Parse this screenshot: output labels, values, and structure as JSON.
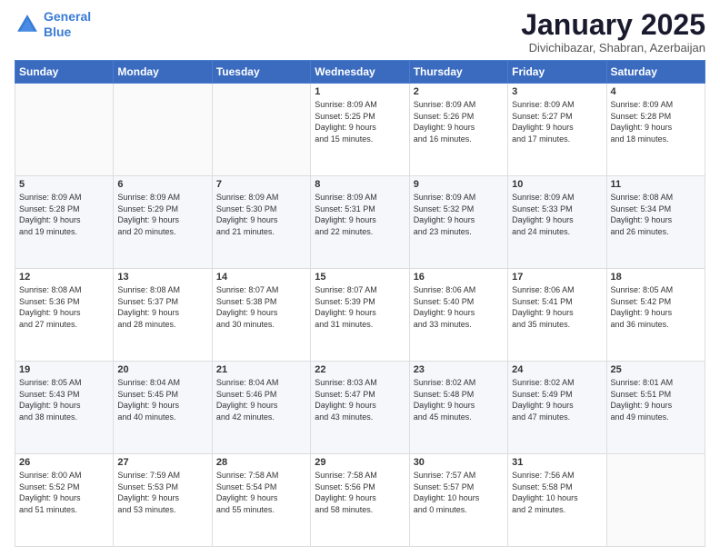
{
  "header": {
    "logo_line1": "General",
    "logo_line2": "Blue",
    "month_year": "January 2025",
    "location": "Divichibazar, Shabran, Azerbaijan"
  },
  "weekdays": [
    "Sunday",
    "Monday",
    "Tuesday",
    "Wednesday",
    "Thursday",
    "Friday",
    "Saturday"
  ],
  "weeks": [
    [
      {
        "day": "",
        "info": ""
      },
      {
        "day": "",
        "info": ""
      },
      {
        "day": "",
        "info": ""
      },
      {
        "day": "1",
        "info": "Sunrise: 8:09 AM\nSunset: 5:25 PM\nDaylight: 9 hours\nand 15 minutes."
      },
      {
        "day": "2",
        "info": "Sunrise: 8:09 AM\nSunset: 5:26 PM\nDaylight: 9 hours\nand 16 minutes."
      },
      {
        "day": "3",
        "info": "Sunrise: 8:09 AM\nSunset: 5:27 PM\nDaylight: 9 hours\nand 17 minutes."
      },
      {
        "day": "4",
        "info": "Sunrise: 8:09 AM\nSunset: 5:28 PM\nDaylight: 9 hours\nand 18 minutes."
      }
    ],
    [
      {
        "day": "5",
        "info": "Sunrise: 8:09 AM\nSunset: 5:28 PM\nDaylight: 9 hours\nand 19 minutes."
      },
      {
        "day": "6",
        "info": "Sunrise: 8:09 AM\nSunset: 5:29 PM\nDaylight: 9 hours\nand 20 minutes."
      },
      {
        "day": "7",
        "info": "Sunrise: 8:09 AM\nSunset: 5:30 PM\nDaylight: 9 hours\nand 21 minutes."
      },
      {
        "day": "8",
        "info": "Sunrise: 8:09 AM\nSunset: 5:31 PM\nDaylight: 9 hours\nand 22 minutes."
      },
      {
        "day": "9",
        "info": "Sunrise: 8:09 AM\nSunset: 5:32 PM\nDaylight: 9 hours\nand 23 minutes."
      },
      {
        "day": "10",
        "info": "Sunrise: 8:09 AM\nSunset: 5:33 PM\nDaylight: 9 hours\nand 24 minutes."
      },
      {
        "day": "11",
        "info": "Sunrise: 8:08 AM\nSunset: 5:34 PM\nDaylight: 9 hours\nand 26 minutes."
      }
    ],
    [
      {
        "day": "12",
        "info": "Sunrise: 8:08 AM\nSunset: 5:36 PM\nDaylight: 9 hours\nand 27 minutes."
      },
      {
        "day": "13",
        "info": "Sunrise: 8:08 AM\nSunset: 5:37 PM\nDaylight: 9 hours\nand 28 minutes."
      },
      {
        "day": "14",
        "info": "Sunrise: 8:07 AM\nSunset: 5:38 PM\nDaylight: 9 hours\nand 30 minutes."
      },
      {
        "day": "15",
        "info": "Sunrise: 8:07 AM\nSunset: 5:39 PM\nDaylight: 9 hours\nand 31 minutes."
      },
      {
        "day": "16",
        "info": "Sunrise: 8:06 AM\nSunset: 5:40 PM\nDaylight: 9 hours\nand 33 minutes."
      },
      {
        "day": "17",
        "info": "Sunrise: 8:06 AM\nSunset: 5:41 PM\nDaylight: 9 hours\nand 35 minutes."
      },
      {
        "day": "18",
        "info": "Sunrise: 8:05 AM\nSunset: 5:42 PM\nDaylight: 9 hours\nand 36 minutes."
      }
    ],
    [
      {
        "day": "19",
        "info": "Sunrise: 8:05 AM\nSunset: 5:43 PM\nDaylight: 9 hours\nand 38 minutes."
      },
      {
        "day": "20",
        "info": "Sunrise: 8:04 AM\nSunset: 5:45 PM\nDaylight: 9 hours\nand 40 minutes."
      },
      {
        "day": "21",
        "info": "Sunrise: 8:04 AM\nSunset: 5:46 PM\nDaylight: 9 hours\nand 42 minutes."
      },
      {
        "day": "22",
        "info": "Sunrise: 8:03 AM\nSunset: 5:47 PM\nDaylight: 9 hours\nand 43 minutes."
      },
      {
        "day": "23",
        "info": "Sunrise: 8:02 AM\nSunset: 5:48 PM\nDaylight: 9 hours\nand 45 minutes."
      },
      {
        "day": "24",
        "info": "Sunrise: 8:02 AM\nSunset: 5:49 PM\nDaylight: 9 hours\nand 47 minutes."
      },
      {
        "day": "25",
        "info": "Sunrise: 8:01 AM\nSunset: 5:51 PM\nDaylight: 9 hours\nand 49 minutes."
      }
    ],
    [
      {
        "day": "26",
        "info": "Sunrise: 8:00 AM\nSunset: 5:52 PM\nDaylight: 9 hours\nand 51 minutes."
      },
      {
        "day": "27",
        "info": "Sunrise: 7:59 AM\nSunset: 5:53 PM\nDaylight: 9 hours\nand 53 minutes."
      },
      {
        "day": "28",
        "info": "Sunrise: 7:58 AM\nSunset: 5:54 PM\nDaylight: 9 hours\nand 55 minutes."
      },
      {
        "day": "29",
        "info": "Sunrise: 7:58 AM\nSunset: 5:56 PM\nDaylight: 9 hours\nand 58 minutes."
      },
      {
        "day": "30",
        "info": "Sunrise: 7:57 AM\nSunset: 5:57 PM\nDaylight: 10 hours\nand 0 minutes."
      },
      {
        "day": "31",
        "info": "Sunrise: 7:56 AM\nSunset: 5:58 PM\nDaylight: 10 hours\nand 2 minutes."
      },
      {
        "day": "",
        "info": ""
      }
    ]
  ]
}
